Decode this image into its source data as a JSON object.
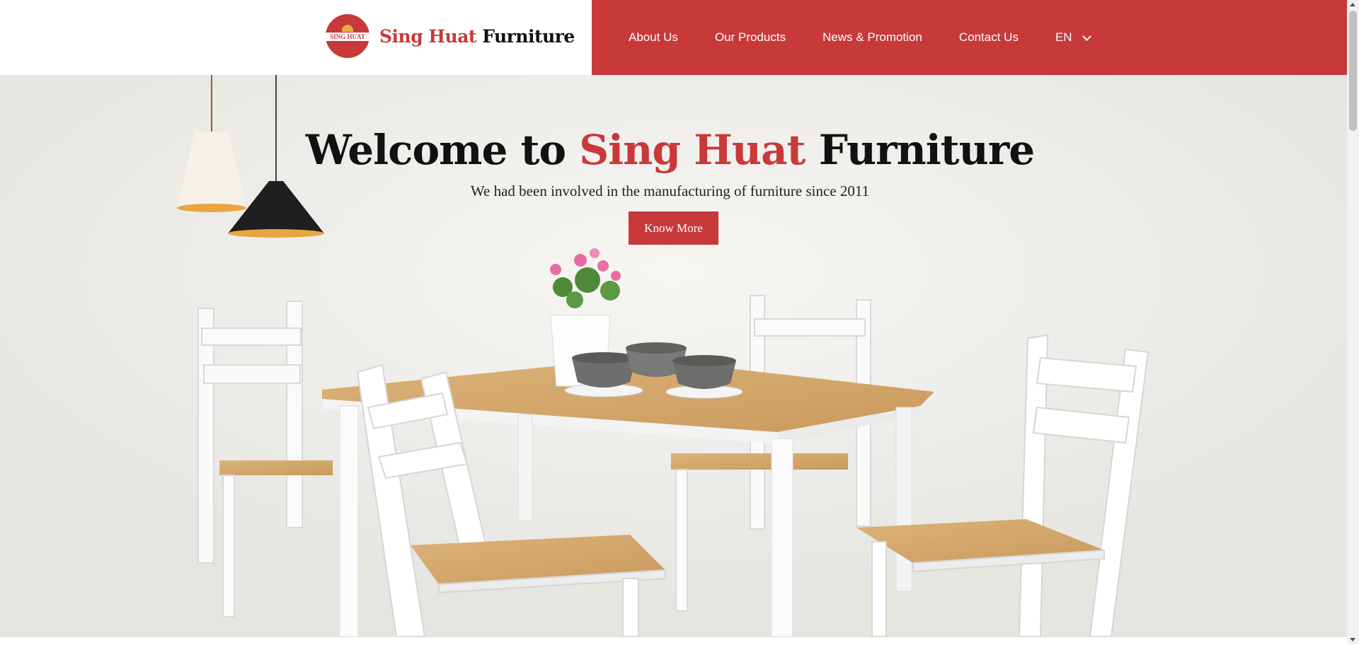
{
  "header": {
    "logo_mark_text": "SING HUAT",
    "brand_accent": "Sing Huat",
    "brand_rest": "Furniture"
  },
  "nav": {
    "items": [
      "About Us",
      "Our Products",
      "News & Promotion",
      "Contact Us"
    ],
    "language": "EN"
  },
  "hero": {
    "title_prefix": "Welcome to",
    "title_accent": "Sing Huat",
    "title_suffix": "Furniture",
    "subtitle": "We had been involved in the manufacturing of furniture since 2011",
    "cta_label": "Know More"
  },
  "colors": {
    "brand_red": "#c8393a",
    "hero_bg": "#ecebe7",
    "text_dark": "#111111"
  },
  "icons": {
    "language_dropdown": "chevron-down-icon"
  }
}
